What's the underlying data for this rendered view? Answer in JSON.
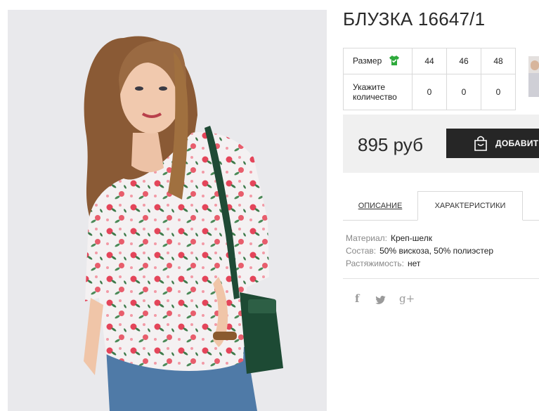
{
  "product": {
    "title": "БЛУЗКА 16647/1",
    "image_alt": "product-photo",
    "price": "895 руб",
    "add_button_label": "ДОБАВИТЬ"
  },
  "size_table": {
    "size_label": "Размер",
    "quantity_label_line1": "Укажите",
    "quantity_label_line2": "количество",
    "sizes": [
      "44",
      "46",
      "48"
    ],
    "quantities": [
      "0",
      "0",
      "0"
    ]
  },
  "tabs": {
    "description": "ОПИСАНИЕ",
    "characteristics": "ХАРАКТЕРИСТИКИ",
    "active": "characteristics"
  },
  "specs": [
    {
      "key": "Материал:",
      "value": "Креп-шелк"
    },
    {
      "key": "Состав:",
      "value": "50% вискоза, 50% полиэстер"
    },
    {
      "key": "Растяжимость:",
      "value": "нет"
    }
  ],
  "social": {
    "facebook": "f",
    "twitter_icon": "twitter-icon",
    "googleplus": "g+"
  },
  "colors": {
    "accent_green": "#2eaa3c",
    "button_dark": "#262626",
    "price_bg": "#f0f0f0"
  }
}
